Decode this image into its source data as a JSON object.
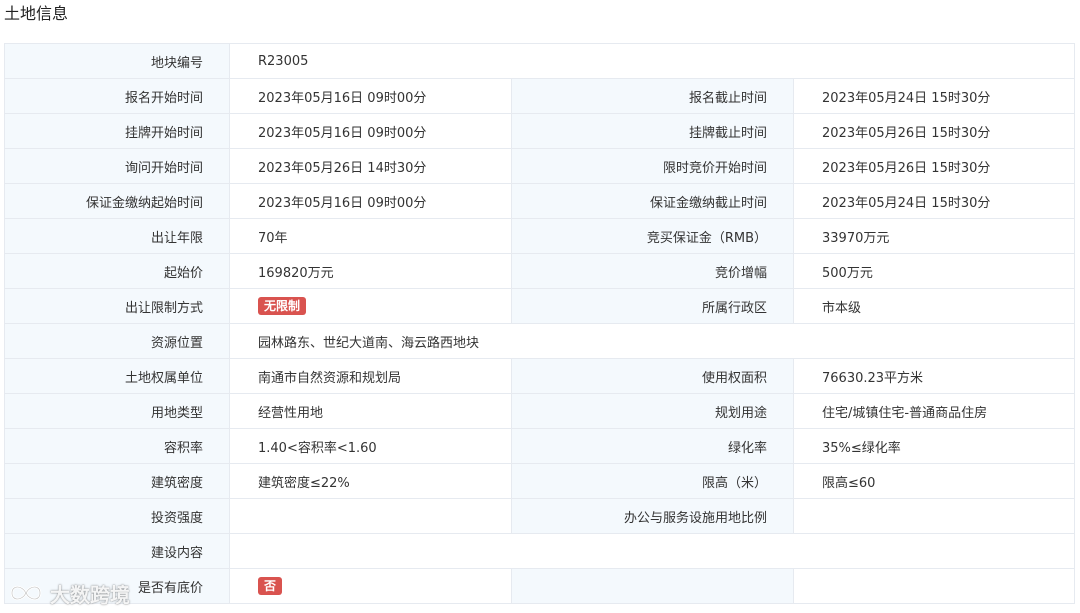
{
  "section_title": "土地信息",
  "rows": [
    {
      "label": "地块编号",
      "value": "R23005"
    },
    {
      "label": "报名开始时间",
      "value": "2023年05月16日 09时00分",
      "label2": "报名截止时间",
      "value2": "2023年05月24日 15时30分"
    },
    {
      "label": "挂牌开始时间",
      "value": "2023年05月16日 09时00分",
      "label2": "挂牌截止时间",
      "value2": "2023年05月26日 15时30分"
    },
    {
      "label": "询问开始时间",
      "value": "2023年05月26日 14时30分",
      "label2": "限时竞价开始时间",
      "value2": "2023年05月26日 15时30分"
    },
    {
      "label": "保证金缴纳起始时间",
      "value": "2023年05月16日 09时00分",
      "label2": "保证金缴纳截止时间",
      "value2": "2023年05月24日 15时30分"
    },
    {
      "label": "出让年限",
      "value": "70年",
      "label2": "竞买保证金（RMB）",
      "value2": "33970万元"
    },
    {
      "label": "起始价",
      "value": "169820万元",
      "label2": "竞价增幅",
      "value2": "500万元"
    },
    {
      "label": "出让限制方式",
      "badge": "无限制",
      "label2": "所属行政区",
      "value2": "市本级"
    },
    {
      "label": "资源位置",
      "value": "园林路东、世纪大道南、海云路西地块"
    },
    {
      "label": "土地权属单位",
      "value": "南通市自然资源和规划局",
      "label2": "使用权面积",
      "value2": "76630.23平方米"
    },
    {
      "label": "用地类型",
      "value": "经营性用地",
      "label2": "规划用途",
      "value2": "住宅/城镇住宅-普通商品住房"
    },
    {
      "label": "容积率",
      "value": "1.40<容积率<1.60",
      "label2": "绿化率",
      "value2": "35%≤绿化率"
    },
    {
      "label": "建筑密度",
      "value": "建筑密度≤22%",
      "label2": "限高（米）",
      "value2": "限高≤60"
    },
    {
      "label": "投资强度",
      "value": "",
      "label2": "办公与服务设施用地比例",
      "value2": ""
    },
    {
      "label": "建设内容",
      "value": ""
    },
    {
      "label": "是否有底价",
      "badge": "否",
      "label2": "",
      "value2": ""
    }
  ],
  "watermark": {
    "text": "大数跨境",
    "logo_icon": "infinity-logo-icon"
  },
  "colors": {
    "label_bg": "#f4f9fd",
    "border": "#e6eaf0",
    "badge_bg": "#d9534f"
  }
}
